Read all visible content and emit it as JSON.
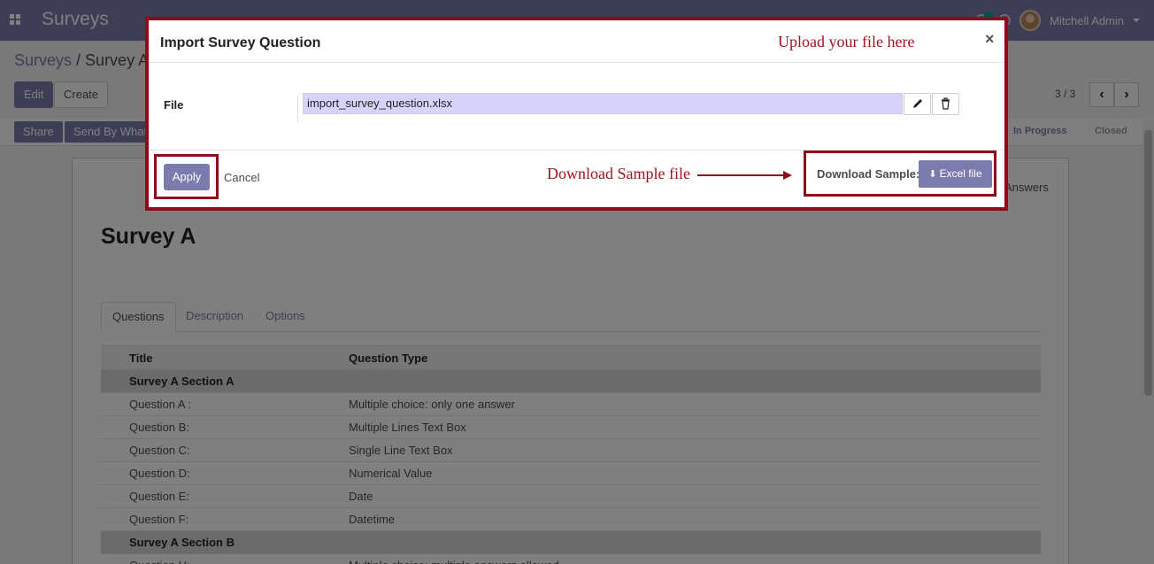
{
  "navbar": {
    "brand": "Surveys",
    "user_name": "Mitchell Admin"
  },
  "control_panel": {
    "breadcrumb_parent": "Surveys",
    "breadcrumb_current": "Survey A",
    "edit_label": "Edit",
    "create_label": "Create",
    "pager": "3 / 3"
  },
  "statusbar": {
    "share_label": "Share",
    "whatsapp_label": "Send By Whatsapp",
    "stages": [
      "In Progress",
      "Closed"
    ]
  },
  "form": {
    "smart_button_label": "Answers",
    "title": "Survey A",
    "tabs": [
      "Questions",
      "Description",
      "Options"
    ],
    "table_headers": [
      "Title",
      "Question Type"
    ],
    "rows": [
      {
        "section": true,
        "title": "Survey A Section A",
        "type": ""
      },
      {
        "section": false,
        "title": "Question A :",
        "type": "Multiple choice: only one answer"
      },
      {
        "section": false,
        "title": "Question B:",
        "type": "Multiple Lines Text Box"
      },
      {
        "section": false,
        "title": "Question C:",
        "type": "Single Line Text Box"
      },
      {
        "section": false,
        "title": "Question D:",
        "type": "Numerical Value"
      },
      {
        "section": false,
        "title": "Question E:",
        "type": "Date"
      },
      {
        "section": false,
        "title": "Question F:",
        "type": "Datetime"
      },
      {
        "section": true,
        "title": "Survey A Section B",
        "type": ""
      },
      {
        "section": false,
        "title": "Question H:",
        "type": "Multiple choice: multiple answers allowed"
      }
    ]
  },
  "dialog": {
    "title": "Import Survey Question",
    "close_glyph": "×",
    "file_label": "File",
    "file_value": "import_survey_question.xlsx",
    "apply_label": "Apply",
    "cancel_label": "Cancel",
    "download_label": "Download Sample:",
    "excel_label": "Excel file"
  },
  "annotations": {
    "upload_note": "Upload your file here",
    "download_note": "Download Sample file"
  },
  "colors": {
    "brand": "#7c7bad",
    "highlight_frame": "#8b0c1a",
    "file_field_bg": "#d7d4fb"
  },
  "icons": [
    "apps-grid-icon",
    "chat-icon",
    "clock-icon",
    "chevron-left-icon",
    "chevron-right-icon",
    "pencil-icon",
    "trash-icon",
    "download-icon",
    "close-icon",
    "caret-down-icon"
  ]
}
